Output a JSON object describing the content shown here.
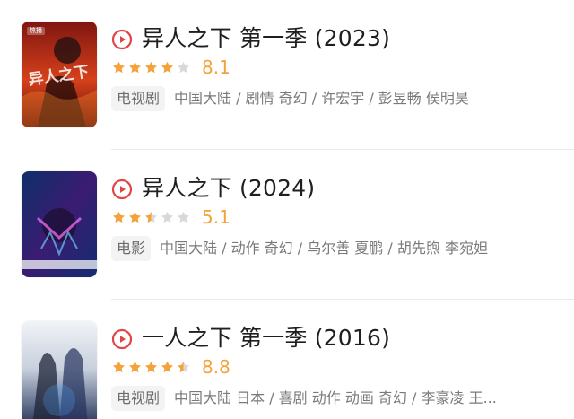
{
  "colors": {
    "accent_red": "#e24545",
    "star_yellow": "#f4a23a",
    "star_gray": "#d9d9d9",
    "meta_gray": "#7a7a7a",
    "tag_bg": "#f3f3f3"
  },
  "results": [
    {
      "title": "异人之下 第一季 (2023)",
      "rating_score": "8.1",
      "rating_stars": 4,
      "type_tag": "电视剧",
      "meta": "中国大陆 / 剧情 奇幻 / 许宏宇 / 彭昱畅 侯明昊",
      "poster_icon": "poster-icon",
      "poster_badge": "热播",
      "poster_caption": "异人之下"
    },
    {
      "title": "异人之下 (2024)",
      "rating_score": "5.1",
      "rating_stars": 2.5,
      "type_tag": "电影",
      "meta": "中国大陆 / 动作 奇幻 / 乌尔善 夏鹏 / 胡先煦 李宛妲",
      "poster_icon": "poster-icon",
      "poster_badge": "",
      "poster_caption": ""
    },
    {
      "title": "一人之下 第一季 (2016)",
      "rating_score": "8.8",
      "rating_stars": 4.5,
      "type_tag": "电视剧",
      "meta": "中国大陆 日本 / 喜剧 动作 动画 奇幻 / 李豪凌 王...",
      "poster_icon": "poster-icon",
      "poster_badge": "",
      "poster_caption": ""
    }
  ]
}
